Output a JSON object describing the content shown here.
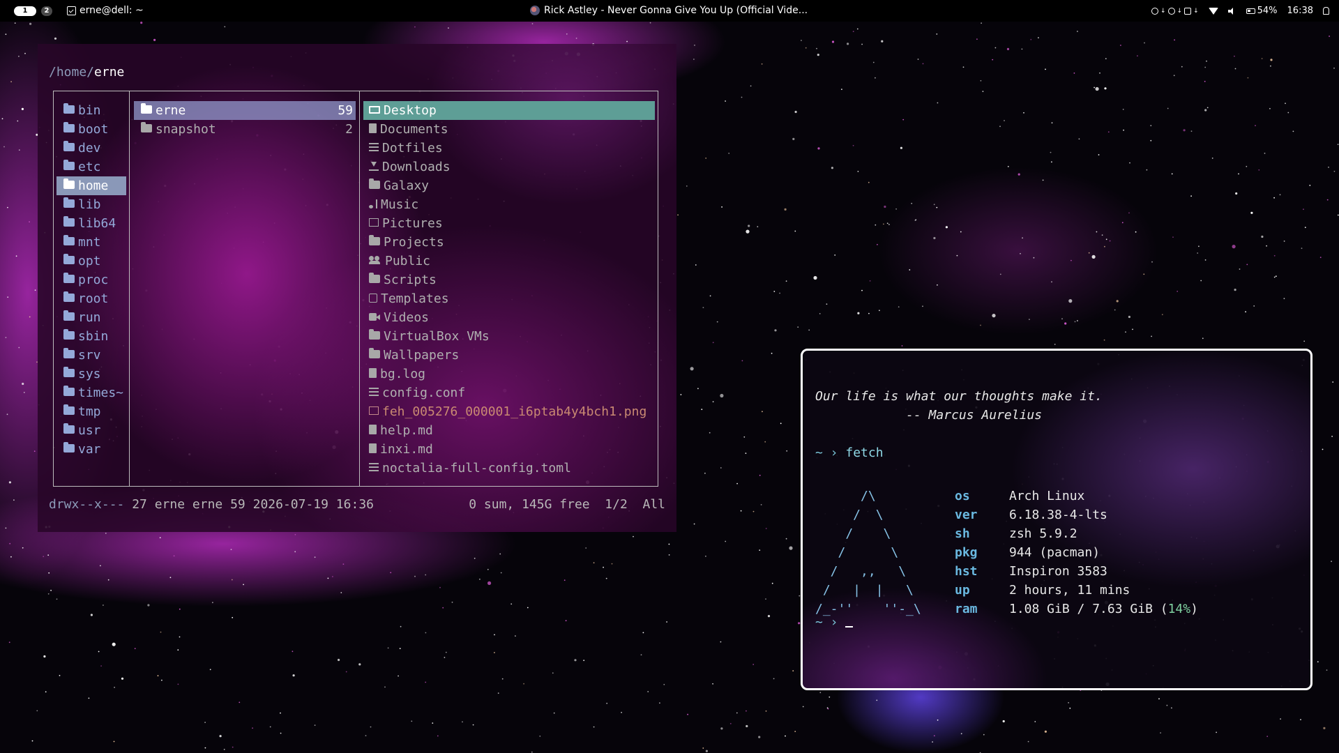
{
  "topbar": {
    "workspaces": [
      "1",
      "2"
    ],
    "active_window": "erne@dell: ~",
    "media_title": "Rick Astley - Never Gonna Give You Up (Official Vide...",
    "battery": "54%",
    "clock": "16:38"
  },
  "file_manager": {
    "path_parent": "/home/",
    "path_current": "erne",
    "root_dirs": [
      "bin",
      "boot",
      "dev",
      "etc",
      "home",
      "lib",
      "lib64",
      "mnt",
      "opt",
      "proc",
      "root",
      "run",
      "sbin",
      "srv",
      "sys",
      "times~",
      "tmp",
      "usr",
      "var"
    ],
    "home_dirs": [
      {
        "name": "erne",
        "count": "59"
      },
      {
        "name": "snapshot",
        "count": "2"
      }
    ],
    "erne_entries": [
      {
        "name": "Desktop",
        "icon": "monitor-icon"
      },
      {
        "name": "Documents",
        "icon": "document-icon"
      },
      {
        "name": "Dotfiles",
        "icon": "sliders-icon"
      },
      {
        "name": "Downloads",
        "icon": "download-icon"
      },
      {
        "name": "Galaxy",
        "icon": "folder-icon"
      },
      {
        "name": "Music",
        "icon": "music-icon"
      },
      {
        "name": "Pictures",
        "icon": "image-icon"
      },
      {
        "name": "Projects",
        "icon": "folder-icon"
      },
      {
        "name": "Public",
        "icon": "users-icon"
      },
      {
        "name": "Scripts",
        "icon": "folder-icon"
      },
      {
        "name": "Templates",
        "icon": "template-icon"
      },
      {
        "name": "Videos",
        "icon": "video-icon"
      },
      {
        "name": "VirtualBox VMs",
        "icon": "folder-icon"
      },
      {
        "name": "Wallpapers",
        "icon": "folder-icon"
      },
      {
        "name": "bg.log",
        "icon": "file-icon"
      },
      {
        "name": "config.conf",
        "icon": "sliders-icon"
      },
      {
        "name": "feh_005276_000001_i6ptab4y4bch1.png",
        "icon": "image-icon"
      },
      {
        "name": "help.md",
        "icon": "file-icon"
      },
      {
        "name": "inxi.md",
        "icon": "file-icon"
      },
      {
        "name": "noctalia-full-config.toml",
        "icon": "sliders-icon"
      }
    ],
    "status_perm": "drwx--x---",
    "status_meta": " 27 erne erne 59 2026-07-19 16:36",
    "status_right": "0 sum, 145G free  1/2  All"
  },
  "terminal": {
    "quote": "Our life is what our thoughts make it.",
    "author": "            -- Marcus Aurelius",
    "prompt": "~ ›",
    "command": "fetch",
    "logo": "      /\\\n     /  \\\n    /    \\\n   /      \\\n  /   ,,   \\\n /   |  |   \\\n/_-''    ''-_\\",
    "info": [
      {
        "key": "os",
        "value": "Arch Linux"
      },
      {
        "key": "ver",
        "value": "6.18.38-4-lts"
      },
      {
        "key": "sh",
        "value": "zsh 5.9.2"
      },
      {
        "key": "pkg",
        "value": "944 (pacman)"
      },
      {
        "key": "hst",
        "value": "Inspiron 3583"
      },
      {
        "key": "up",
        "value": "2 hours, 11 mins"
      }
    ],
    "ram_key": "ram",
    "ram_value": "1.08 GiB / 7.63 GiB (",
    "ram_pct": "14%",
    "ram_close": ")",
    "prompt2": "~ ›"
  },
  "colors": {
    "accent_selection": "#5e9e96",
    "dir_color": "#94a9d9",
    "png_color": "#c98a72",
    "terminal_key": "#6ab8e0"
  }
}
